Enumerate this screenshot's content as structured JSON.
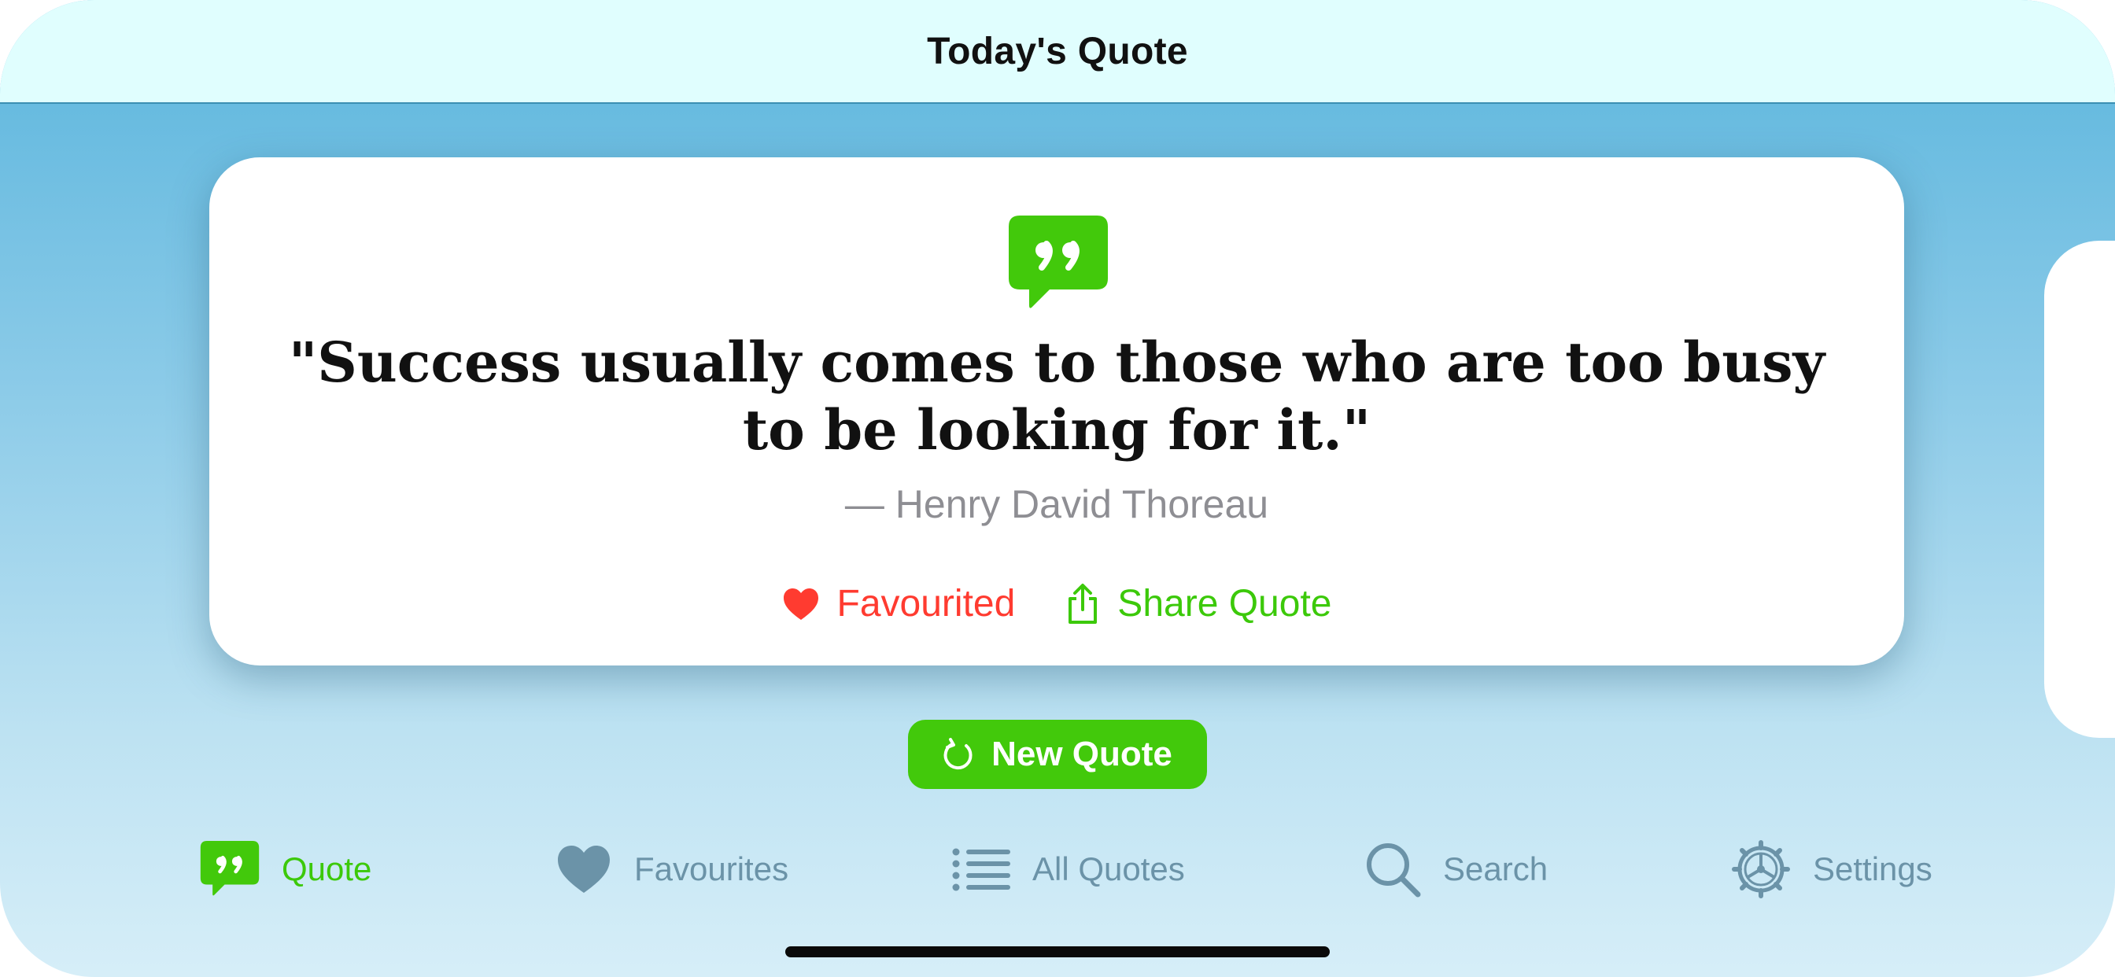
{
  "header": {
    "title": "Today's Quote"
  },
  "card": {
    "icon": "quote-bubble-icon",
    "quote": "\"Success usually comes to those who are too busy to be looking for it.\"",
    "author": "— Henry David Thoreau",
    "favourite_label": "Favourited",
    "share_label": "Share Quote"
  },
  "new_quote_button": {
    "label": "New Quote",
    "icon": "refresh-icon"
  },
  "tabs": [
    {
      "label": "Quote",
      "icon": "quote-bubble-icon",
      "active": true
    },
    {
      "label": "Favourites",
      "icon": "heart-icon",
      "active": false
    },
    {
      "label": "All Quotes",
      "icon": "list-icon",
      "active": false
    },
    {
      "label": "Search",
      "icon": "search-icon",
      "active": false
    },
    {
      "label": "Settings",
      "icon": "gear-icon",
      "active": false
    }
  ],
  "colors": {
    "accent_green": "#42c90b",
    "favourite_red": "#ff3b30",
    "inactive_tab": "#6b93a8",
    "header_bg": "#e0fefe"
  }
}
